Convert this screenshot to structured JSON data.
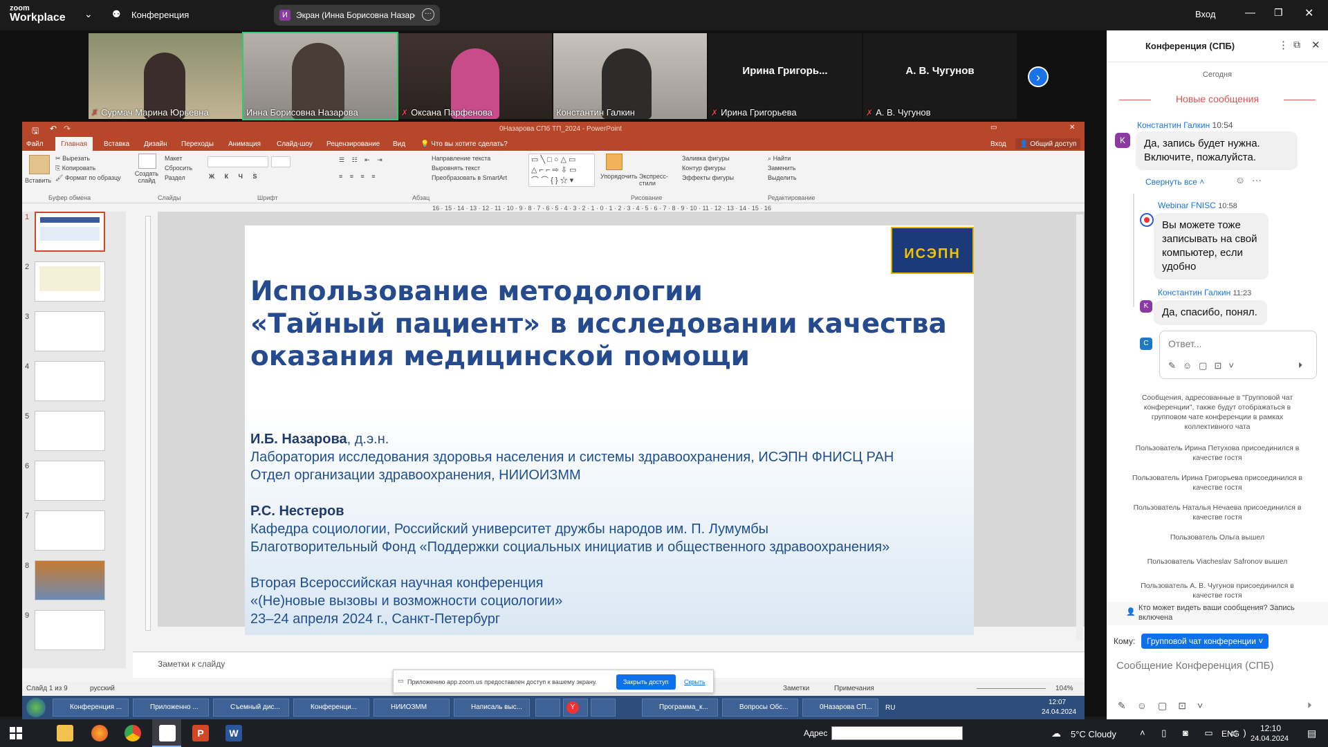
{
  "zoom": {
    "logo_top": "zoom",
    "logo_bottom": "Workplace",
    "meeting": "Конференция",
    "share_title": "Экран (Инна Борисовна Назаро",
    "sign_in": "Вход"
  },
  "participants": [
    {
      "name": "Сурмач Марина Юрьевна"
    },
    {
      "name": "Инна Борисовна Назарова"
    },
    {
      "name": "Оксана Парфенова"
    },
    {
      "name": "Константин Галкин"
    },
    {
      "big": "Ирина  Григорь...",
      "name": "Ирина Григорьева"
    },
    {
      "big": "А. В. Чугунов",
      "name": "А. В. Чугунов"
    }
  ],
  "ppt": {
    "title": "0Назарова СПб ТП_2024  -  PowerPoint",
    "menu": [
      "Файл",
      "Главная",
      "Вставка",
      "Дизайн",
      "Переходы",
      "Анимация",
      "Слайд-шоу",
      "Рецензирование",
      "Вид"
    ],
    "tellme": "Что вы хотите сделать?",
    "sign_in": "Вход",
    "share": "Общий доступ",
    "ribbon": {
      "paste": "Вставить",
      "cut": "Вырезать",
      "copy": "Копировать",
      "format": "Формат по образцу",
      "clipboard": "Буфер обмена",
      "new_slide": "Создать слайд",
      "layout": "Макет",
      "reset": "Сбросить",
      "section": "Раздел",
      "slides": "Слайды",
      "font": "Шрифт",
      "paragraph": "Абзац",
      "text_dir": "Направление текста",
      "align": "Выровнять текст",
      "smartart": "Преобразовать в SmartArt",
      "arrange": "Упорядочить",
      "quick_styles": "Экспресс-стили",
      "fill": "Заливка фигуры",
      "outline": "Контур фигуры",
      "effects": "Эффекты фигуры",
      "drawing": "Рисование",
      "find": "Найти",
      "replace": "Заменить",
      "select": "Выделить",
      "editing": "Редактирование"
    },
    "ruler": "16 · 15 · 14 · 13 · 12 · 11 · 10 · 9 · 8 · 7 · 6 · 5 · 4 · 3 · 2 · 1 · 0 · 1 · 2 · 3 · 4 · 5 · 6 · 7 · 8 · 9 · 10 · 11 · 12 · 13 · 14 · 15 · 16",
    "thumbs": [
      "1",
      "2",
      "3",
      "4",
      "5",
      "6",
      "7",
      "8",
      "9"
    ],
    "slide": {
      "logo": "ИСЭПН",
      "title1": "Использование методологии",
      "title2": "«Тайный пациент» в исследовании качества",
      "title3": "оказания медицинской помощи",
      "a1_name": "И.Б. Назарова",
      "a1_deg": ", д.э.н.",
      "a1_l1": "Лаборатория исследования здоровья населения и системы здравоохранения, ИСЭПН ФНИСЦ РАН",
      "a1_l2": "Отдел организации здравоохранения, НИИОИЗММ",
      "a2_name": "Р.С. Нестеров",
      "a2_l1": "Кафедра социологии, Российский университет дружбы народов им. П. Лумумбы",
      "a2_l2": "Благотворительный Фонд «Поддержки социальных инициатив и общественного здравоохранения»",
      "conf1": "Вторая Всероссийская научная конференция",
      "conf2": "«(Не)новые вызовы и возможности социологии»",
      "conf3": "23–24 апреля 2024 г., Санкт-Петербург"
    },
    "notes": "Заметки к слайду",
    "status": {
      "slide": "Слайд 1 из 9",
      "lang": "русский",
      "notes": "Заметки",
      "comments": "Примечания",
      "zoom": "104%"
    },
    "share_notice": "Приложению app.zoom.us предоставлен доступ к вашему экрану.",
    "stop": "Закрыть доступ",
    "hide": "Скрыть"
  },
  "taskbar_win7": {
    "items": [
      "Конференция ...",
      "Приложенно ...",
      "Съемный дис...",
      "Конференци...",
      "НИИОЗММ",
      "Написаль выс...",
      "",
      "",
      "Программа_к...",
      "Вопросы Обс...",
      "0Назарова СП..."
    ],
    "lang": "RU",
    "time": "12:07",
    "date": "24.04.2024"
  },
  "chat": {
    "title": "Конференция (СПБ)",
    "today": "Сегодня",
    "new": "Новые сообщения",
    "m1_author": "Константин Галкин",
    "m1_time": "10:54",
    "m1_text": "Да, запись будет нужна. Включите, пожалуйста.",
    "collapse": "Свернуть все",
    "m2_author": "Webinar FNISC",
    "m2_time": "10:58",
    "m2_text": "Вы можете тоже записывать на свой компьютер, если удобно",
    "m3_author": "Константин Галкин",
    "m3_time": "11:23",
    "m3_text": "Да, спасибо, понял.",
    "reply_ph": "Ответ...",
    "sys": [
      "Сообщения, адресованные в \"Групповой чат конференции\", также будут отображаться в групповом чате конференции в рамках коллективного чата",
      "Пользователь Ирина Петухова присоединился в качестве гостя",
      "Пользователь Ирина Григорьева присоединился в качестве гостя",
      "Пользователь Наталья Нечаева присоединился в качестве гостя",
      "Пользователь Ольга вышел",
      "Пользователь Viacheslav Safronov вышел",
      "Пользователь А. В. Чугунов присоединился в качестве гостя"
    ],
    "who": "Кто может видеть ваши сообщения? Запись включена",
    "to_label": "Кому:",
    "to_value": "Групповой чат конференции",
    "input_ph": "Сообщение Конференция (СПБ)",
    "avatar_k": "K",
    "avatar_c": "C"
  },
  "taskbar_win10": {
    "address_label": "Адрес",
    "weather": "5°C  Cloudy",
    "lang": "ENG",
    "time": "12:10",
    "date": "24.04.2024"
  }
}
